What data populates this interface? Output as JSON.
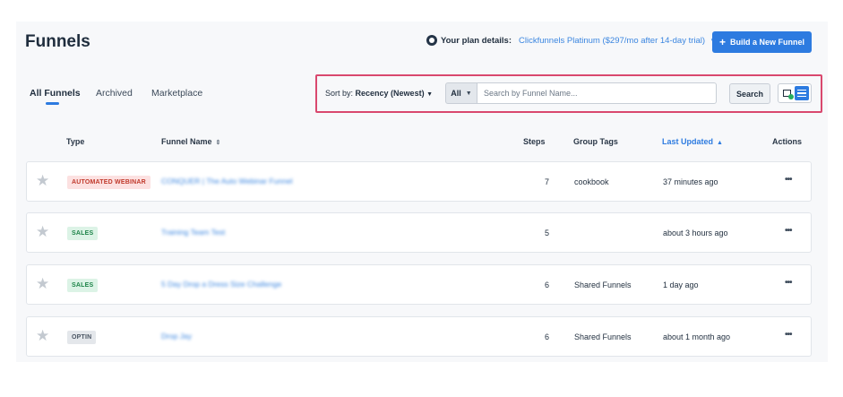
{
  "header": {
    "title": "Funnels",
    "plan_label": "Your plan details:",
    "plan_value": "Clickfunnels Platinum ($297/mo after 14-day trial)",
    "build_button": "Build a New Funnel"
  },
  "tabs": [
    {
      "label": "All Funnels",
      "active": true
    },
    {
      "label": "Archived",
      "active": false
    },
    {
      "label": "Marketplace",
      "active": false
    }
  ],
  "filters": {
    "sort_prefix": "Sort by:",
    "sort_value": "Recency (Newest)",
    "scope_value": "All",
    "search_placeholder": "Search by Funnel Name...",
    "search_button": "Search"
  },
  "table": {
    "columns": {
      "type": "Type",
      "name": "Funnel Name",
      "steps": "Steps",
      "tags": "Group Tags",
      "updated": "Last Updated",
      "actions": "Actions"
    },
    "rows": [
      {
        "badge": "AUTOMATED WEBINAR",
        "badge_kind": "webinar",
        "name": "CONQUER | The Auto Webinar Funnel",
        "steps": "7",
        "tags": "cookbook",
        "updated": "37 minutes ago",
        "actions": "•••"
      },
      {
        "badge": "SALES",
        "badge_kind": "sales",
        "name": "Training Team Test",
        "steps": "5",
        "tags": "",
        "updated": "about 3 hours ago",
        "actions": "•••"
      },
      {
        "badge": "SALES",
        "badge_kind": "sales",
        "name": "5 Day Drop a Dress Size Challenge",
        "steps": "6",
        "tags": "Shared Funnels",
        "updated": "1 day ago",
        "actions": "•••"
      },
      {
        "badge": "OPTIN",
        "badge_kind": "optin",
        "name": "Drop Jay",
        "steps": "6",
        "tags": "Shared Funnels",
        "updated": "about 1 month ago",
        "actions": "•••"
      }
    ]
  },
  "colors": {
    "accent": "#2d7be0",
    "highlight_border": "#d9486e"
  }
}
